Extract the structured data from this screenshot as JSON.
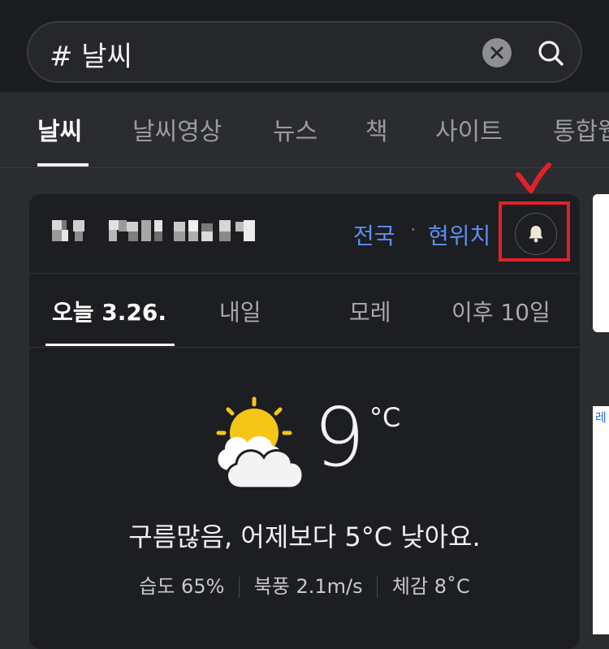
{
  "search": {
    "query": "# 날씨"
  },
  "tabs": [
    {
      "label": "날씨",
      "active": true
    },
    {
      "label": "날씨영상",
      "active": false
    },
    {
      "label": "뉴스",
      "active": false
    },
    {
      "label": "책",
      "active": false
    },
    {
      "label": "사이트",
      "active": false
    },
    {
      "label": "통합웹",
      "active": false
    }
  ],
  "card": {
    "location_links": {
      "nationwide": "전국",
      "separator": "·",
      "current": "현위치"
    },
    "day_tabs": [
      {
        "label": "오늘 3.26.",
        "active": true
      },
      {
        "label": "내일",
        "active": false
      },
      {
        "label": "모레",
        "active": false
      },
      {
        "label": "이후 10일",
        "active": false
      }
    ],
    "weather": {
      "icon": "partly-cloudy-icon",
      "temperature": "9",
      "unit": "°C",
      "summary": "구름많음, 어제보다 5°C 낮아요.",
      "humidity": "습도 65%",
      "wind": "북풍 2.1m/s",
      "feels_like": "체감 8˚C"
    }
  },
  "side": {
    "map_label": "레"
  },
  "colors": {
    "accent_link": "#5b8ff1",
    "annotation_red": "#e2202a",
    "sun": "#f5c518"
  }
}
